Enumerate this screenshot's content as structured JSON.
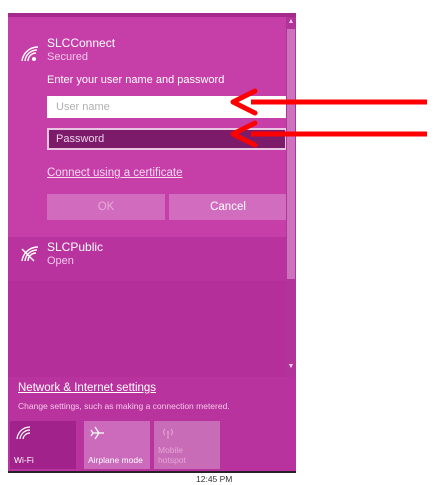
{
  "networks": [
    {
      "name": "SLCConnect",
      "status": "Secured",
      "icon": "wifi-secured-icon"
    },
    {
      "name": "SLCPublic",
      "status": "Open",
      "icon": "wifi-open-icon"
    }
  ],
  "login": {
    "prompt": "Enter your user name and password",
    "username_placeholder": "User name",
    "password_placeholder": "Password",
    "certificate_link": "Connect using a certificate",
    "ok_label": "OK",
    "cancel_label": "Cancel"
  },
  "settings": {
    "link": "Network & Internet settings",
    "description": "Change settings, such as making a connection metered."
  },
  "quick_actions": [
    {
      "label": "Wi-Fi",
      "icon": "wifi-icon",
      "active": true
    },
    {
      "label": "Airplane mode",
      "icon": "airplane-icon",
      "active": false
    },
    {
      "label": "Mobile hotspot",
      "icon": "hotspot-icon",
      "active": false
    }
  ],
  "taskbar": {
    "time": "12:45 PM"
  },
  "colors": {
    "panel": "#b9339f",
    "expanded": "#c63ea8",
    "tile_active": "#a0228a",
    "arrow": "#ff0000"
  }
}
